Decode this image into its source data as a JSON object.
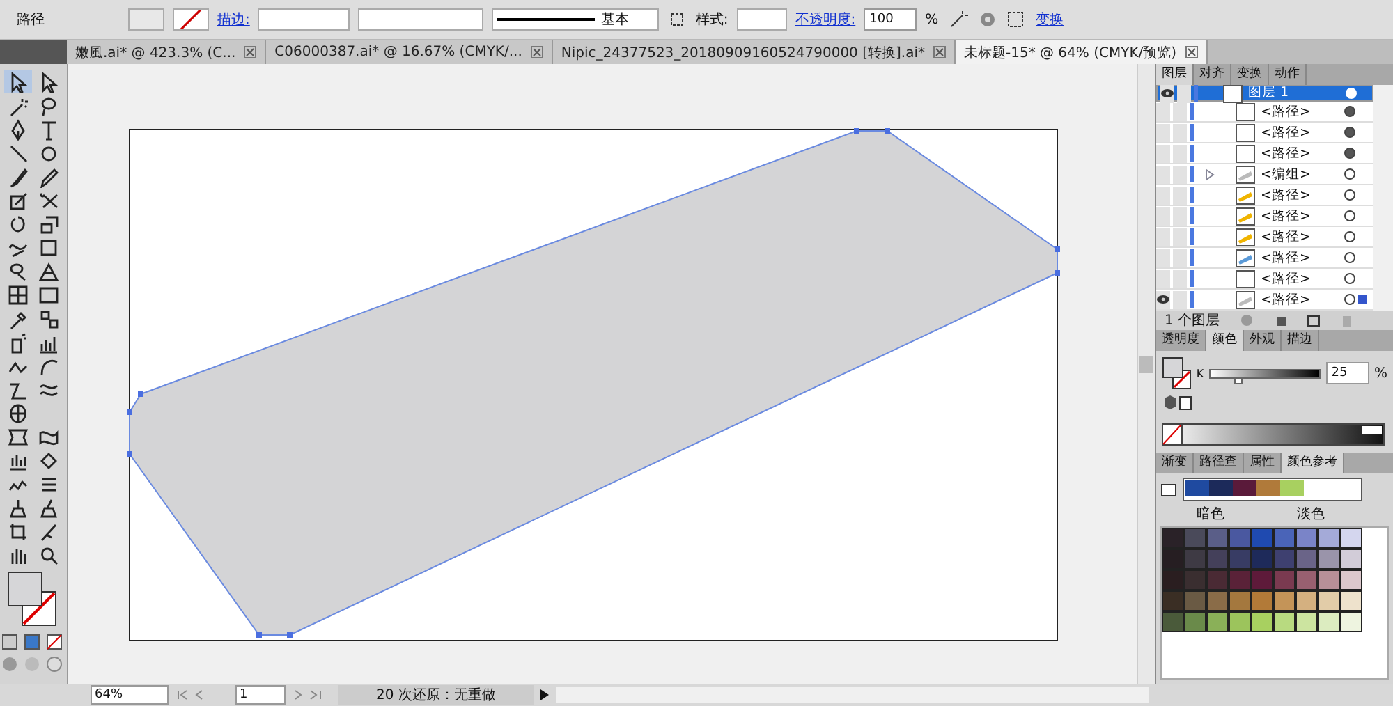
{
  "control_bar": {
    "object_label": "路径",
    "stroke_link": "描边:",
    "stroke_profile": "基本",
    "style_label": "样式:",
    "opacity_link": "不透明度:",
    "opacity_value": "100",
    "opacity_unit": "%",
    "transform_link": "变换"
  },
  "doc_tabs": [
    {
      "label": "嫩風.ai* @ 423.3% (C...",
      "selected": false
    },
    {
      "label": "C06000387.ai* @ 16.67% (CMYK/...",
      "selected": false
    },
    {
      "label": "Nipic_24377523_20180909160524790000  [转换].ai*",
      "selected": false
    },
    {
      "label": "未标题-15* @ 64% (CMYK/预览)",
      "selected": true
    }
  ],
  "layers_panel": {
    "tabs": [
      {
        "label": "图层",
        "selected": true
      },
      {
        "label": "对齐",
        "selected": false
      },
      {
        "label": "变换",
        "selected": false
      },
      {
        "label": "动作",
        "selected": false
      }
    ],
    "rows": [
      {
        "label": "图层 1",
        "kind": "layer",
        "target_filled": false,
        "target_selected": false,
        "visible": true,
        "selected": true
      },
      {
        "label": "<路径>",
        "kind": "item",
        "target_filled": true,
        "target_selected": false,
        "visible": false,
        "selected": false
      },
      {
        "label": "<路径>",
        "kind": "item",
        "target_filled": true,
        "target_selected": false,
        "visible": false,
        "selected": false
      },
      {
        "label": "<路径>",
        "kind": "item",
        "target_filled": true,
        "target_selected": false,
        "visible": false,
        "selected": false
      },
      {
        "label": "<编组>",
        "kind": "group",
        "color": "#bbbbbb",
        "target_filled": false,
        "target_selected": false,
        "visible": false,
        "selected": false
      },
      {
        "label": "<路径>",
        "kind": "item",
        "color": "#f0b400",
        "target_filled": false,
        "target_selected": false,
        "visible": false,
        "selected": false
      },
      {
        "label": "<路径>",
        "kind": "item",
        "color": "#f0b400",
        "target_filled": false,
        "target_selected": false,
        "visible": false,
        "selected": false
      },
      {
        "label": "<路径>",
        "kind": "item",
        "color": "#f0b400",
        "target_filled": false,
        "target_selected": false,
        "visible": false,
        "selected": false
      },
      {
        "label": "<路径>",
        "kind": "item",
        "color": "#5a9ad8",
        "target_filled": false,
        "target_selected": false,
        "visible": false,
        "selected": false
      },
      {
        "label": "<路径>",
        "kind": "item",
        "target_filled": false,
        "target_selected": false,
        "visible": false,
        "selected": false
      },
      {
        "label": "<路径>",
        "kind": "item",
        "color": "#bbbbbb",
        "target_filled": false,
        "target_selected": true,
        "visible": true,
        "selected": false
      }
    ],
    "footer": "1 个图层"
  },
  "color_panel": {
    "tabs": [
      {
        "label": "透明度",
        "selected": false
      },
      {
        "label": "颜色",
        "selected": true
      },
      {
        "label": "外观",
        "selected": false
      },
      {
        "label": "描边",
        "selected": false
      }
    ],
    "channel": "K",
    "level": 0.25,
    "value": "25",
    "unit": "%"
  },
  "guide_panel": {
    "tabs": [
      {
        "label": "渐变",
        "selected": false
      },
      {
        "label": "路径查",
        "selected": false
      },
      {
        "label": "属性",
        "selected": false
      },
      {
        "label": "颜色参考",
        "selected": true
      }
    ],
    "harmony": [
      {
        "color": "#1f4aa0"
      },
      {
        "color": "#1c2a5a"
      },
      {
        "color": "#5a1a3a"
      },
      {
        "color": "#b07a3a"
      },
      {
        "color": "#a8d060"
      }
    ],
    "dark_label": "暗色",
    "light_label": "淡色",
    "grid": [
      {
        "cells": [
          {
            "color": "#2a2228"
          },
          {
            "color": "#4a4a5a"
          },
          {
            "color": "#5a5e88"
          },
          {
            "color": "#4a58a0"
          },
          {
            "color": "#1f4ab0"
          },
          {
            "color": "#4a64b8"
          },
          {
            "color": "#7a84c8"
          },
          {
            "color": "#a4aad8"
          },
          {
            "color": "#d4d6ee"
          }
        ]
      },
      {
        "cells": [
          {
            "color": "#261e22"
          },
          {
            "color": "#3e3a44"
          },
          {
            "color": "#44405a"
          },
          {
            "color": "#383c64"
          },
          {
            "color": "#1e2a5a"
          },
          {
            "color": "#3e4070"
          },
          {
            "color": "#6a6488"
          },
          {
            "color": "#9a94aa"
          },
          {
            "color": "#d2ccd8"
          }
        ]
      },
      {
        "cells": [
          {
            "color": "#2a1e20"
          },
          {
            "color": "#3a2e30"
          },
          {
            "color": "#4a2a34"
          },
          {
            "color": "#5a2238"
          },
          {
            "color": "#5e1a3a"
          },
          {
            "color": "#7a3a50"
          },
          {
            "color": "#986070"
          },
          {
            "color": "#b89098"
          },
          {
            "color": "#dcc8cc"
          }
        ]
      },
      {
        "cells": [
          {
            "color": "#3a2e24"
          },
          {
            "color": "#6a5a44"
          },
          {
            "color": "#8a6c48"
          },
          {
            "color": "#a4783e"
          },
          {
            "color": "#b27a38"
          },
          {
            "color": "#c49458"
          },
          {
            "color": "#d4b080"
          },
          {
            "color": "#e2cca8"
          },
          {
            "color": "#eee2cc"
          }
        ]
      },
      {
        "cells": [
          {
            "color": "#4a5a3a"
          },
          {
            "color": "#6a8a4a"
          },
          {
            "color": "#8ab058"
          },
          {
            "color": "#9cc45c"
          },
          {
            "color": "#a8d060"
          },
          {
            "color": "#b8da80"
          },
          {
            "color": "#cce4a0"
          },
          {
            "color": "#dcecc0"
          },
          {
            "color": "#eef4e0"
          }
        ]
      }
    ]
  },
  "status_bar": {
    "zoom": "64%",
    "artboard": "1",
    "history": "20 次还原：无重做"
  }
}
